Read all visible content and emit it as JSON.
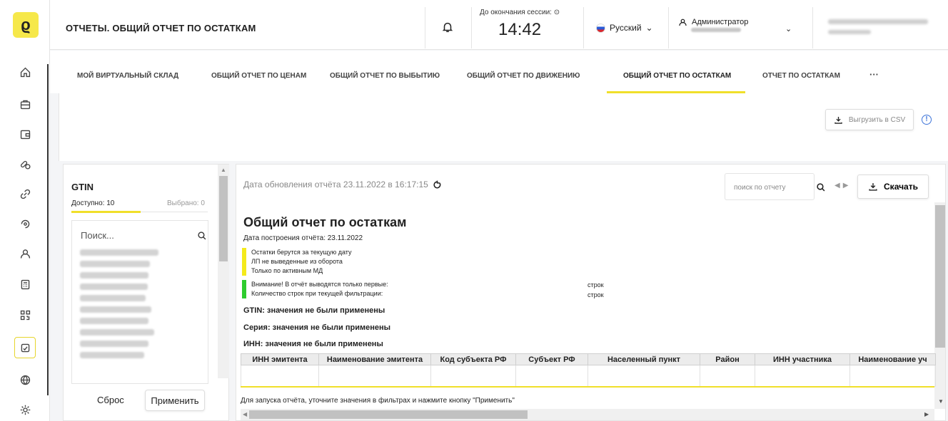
{
  "header": {
    "logo": "ϱ",
    "title": "ОТЧЕТЫ. ОБЩИЙ ОТЧЕТ ПО ОСТАТКАМ",
    "session_label": "До окончания сессии:",
    "session_time": "14:42",
    "language": "Русский",
    "user_role": "Администратор"
  },
  "rail": {
    "items": [
      "home-icon",
      "briefcase-icon",
      "wallet-icon",
      "pills-icon",
      "link-icon",
      "refresh-icon",
      "user-icon",
      "calculator-icon",
      "qr-code-icon",
      "report-icon",
      "globe-icon",
      "settings-icon"
    ],
    "active": "report-icon"
  },
  "tabs": [
    {
      "label": "МОЙ ВИРТУАЛЬНЫЙ СКЛАД"
    },
    {
      "label": "ОБЩИЙ ОТЧЕТ ПО ЦЕНАМ"
    },
    {
      "label": "ОБЩИЙ ОТЧЕТ ПО ВЫБЫТИЮ"
    },
    {
      "label": "ОБЩИЙ ОТЧЕТ ПО ДВИЖЕНИЮ"
    },
    {
      "label": "ОБЩИЙ ОТЧЕТ ПО ОСТАТКАМ",
      "active": true
    },
    {
      "label": "ОТЧЕТ ПО ОСТАТКАМ"
    },
    {
      "label": "···"
    }
  ],
  "toolbar": {
    "csv_label": "Выгрузить в CSV"
  },
  "filter": {
    "title": "GTIN",
    "available": "Доступно: 10",
    "selected": "Выбрано: 0",
    "search_placeholder": "Поиск...",
    "reset_label": "Сброс",
    "apply_label": "Применить"
  },
  "report": {
    "updated": "Дата обновления отчёта 23.11.2022 в 16:17:15",
    "search_placeholder": "поиск по отчету",
    "download_label": "Скачать",
    "title": "Общий отчет по остаткам",
    "built": "Дата построения отчёта: 23.11.2022",
    "notes_yellow": [
      "Остатки берутся за текущую дату",
      "ЛП не выведенные из оборота",
      "Только по активным МД"
    ],
    "notes_green": [
      "Внимание! В отчёт выводятся только первые:",
      "Количество строк при текущей фильтрации:"
    ],
    "strok": "строк",
    "filters": [
      "GTIN: значения не были применены",
      "Серия: значения не были применены",
      "ИНН: значения не были применены"
    ],
    "columns": [
      "ИНН эмитента",
      "Наименование эмитента",
      "Код субъекта РФ",
      "Субъект РФ",
      "Населенный пункт",
      "Район",
      "ИНН участника",
      "Наименование уч"
    ],
    "hint": "Для запуска отчёта, уточните значения в фильтрах и нажмите кнопку \"Применить\""
  }
}
